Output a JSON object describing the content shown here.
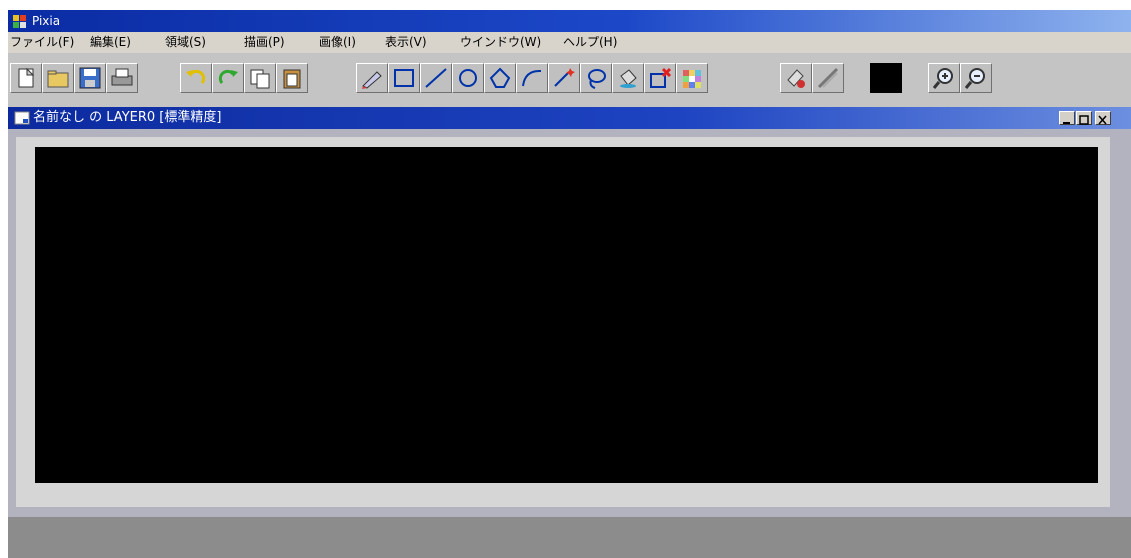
{
  "app": {
    "title": "Pixia",
    "menu": [
      "ファイル(F)",
      "編集(E)",
      "領域(S)",
      "描画(P)",
      "画像(I)",
      "表示(V)",
      "ウインドウ(W)",
      "ヘルプ(H)"
    ]
  },
  "toolbar": {
    "tools": [
      "new-file",
      "open-file",
      "save-file",
      "print",
      "undo",
      "redo",
      "copy",
      "paste",
      "pen",
      "rectangle",
      "line",
      "ellipse",
      "polygon-lasso",
      "curve",
      "magic-wand",
      "lasso",
      "fill-bucket",
      "delete-area",
      "color-mosaic",
      "paint",
      "ruler",
      "foreground-color",
      "zoom-in",
      "zoom-out"
    ],
    "foreground_color": "#000000"
  },
  "document": {
    "title": "名前なし の LAYER0 [標準精度]",
    "canvas_color": "#000000"
  }
}
